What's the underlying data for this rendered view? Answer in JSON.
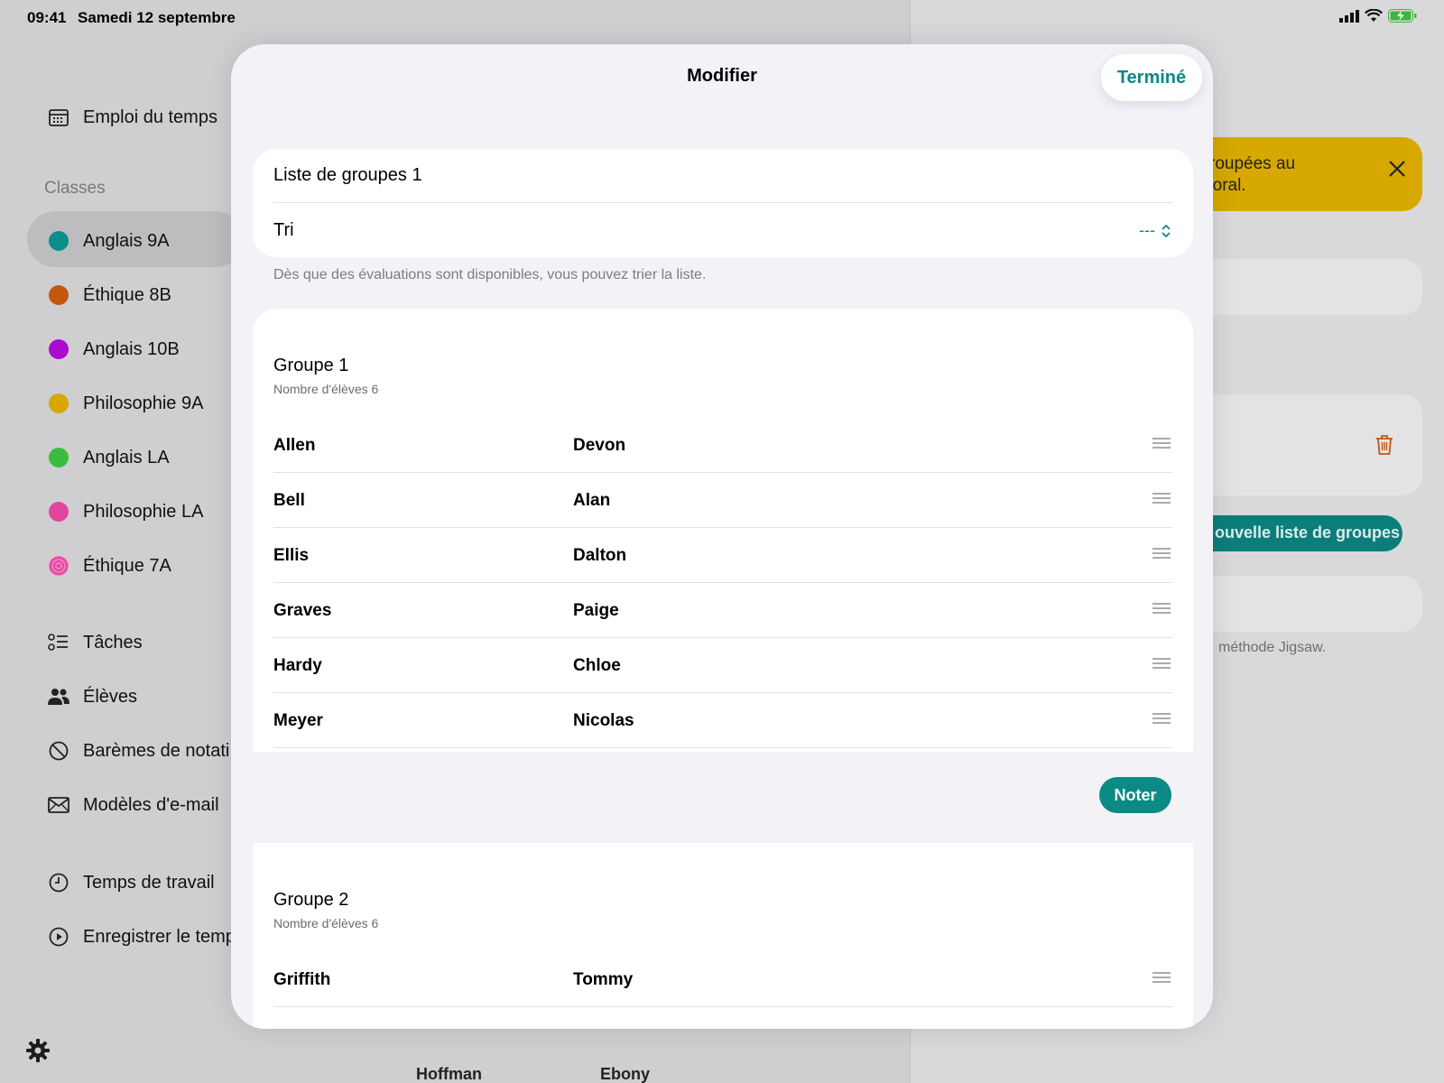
{
  "status_bar": {
    "time": "09:41",
    "date": "Samedi 12 septembre"
  },
  "sidebar": {
    "schedule": "Emploi du temps",
    "classes_header": "Classes",
    "classes": [
      {
        "label": "Anglais 9A",
        "color": "#0a8f8a"
      },
      {
        "label": "Éthique 8B",
        "color": "#c4570e"
      },
      {
        "label": "Anglais 10B",
        "color": "#a90bd0"
      },
      {
        "label": "Philosophie 9A",
        "color": "#d6a800"
      },
      {
        "label": "Anglais LA",
        "color": "#3cbc3c"
      },
      {
        "label": "Philosophie LA",
        "color": "#e2459e"
      },
      {
        "label": "Éthique 7A",
        "color": "#e2459e"
      }
    ],
    "tasks": "Tâches",
    "students": "Élèves",
    "grading": "Barèmes de notati",
    "email_templates": "Modèles d'e-mail",
    "work_time": "Temps de travail",
    "record_time": "Enregistrer le temp"
  },
  "right_panel": {
    "banner_line1": "roupées au",
    "banner_line2": "'oral.",
    "new_list_button": "ouvelle liste de groupes",
    "jigsaw_text": "méthode Jigsaw.",
    "behind_last": "Hoffman",
    "behind_first": "Ebony"
  },
  "modal": {
    "title": "Modifier",
    "done": "Terminé",
    "list_name": "Liste de groupes 1",
    "sort_label": "Tri",
    "sort_value": "---",
    "hint": "Dès que des évaluations sont disponibles, vous pouvez trier la liste.",
    "grade_button": "Noter",
    "groups": [
      {
        "title": "Groupe 1",
        "subtitle": "Nombre d'élèves 6",
        "students": [
          {
            "last": "Allen",
            "first": "Devon"
          },
          {
            "last": "Bell",
            "first": "Alan"
          },
          {
            "last": "Ellis",
            "first": "Dalton"
          },
          {
            "last": "Graves",
            "first": "Paige"
          },
          {
            "last": "Hardy",
            "first": "Chloe"
          },
          {
            "last": "Meyer",
            "first": "Nicolas"
          }
        ]
      },
      {
        "title": "Groupe 2",
        "subtitle": "Nombre d'élèves 6",
        "students": [
          {
            "last": "Griffith",
            "first": "Tommy"
          }
        ]
      }
    ]
  }
}
